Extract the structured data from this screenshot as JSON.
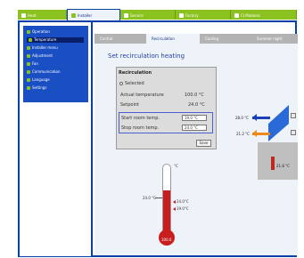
{
  "top_tabs": [
    {
      "label": "Heat",
      "active": false
    },
    {
      "label": "Installer",
      "active": true
    },
    {
      "label": "Service",
      "active": false
    },
    {
      "label": "Factory",
      "active": false
    },
    {
      "label": "CI Modules",
      "active": false
    }
  ],
  "sidebar": {
    "items": [
      {
        "label": "Operation",
        "active": false
      },
      {
        "label": "Temperature",
        "active": true
      },
      {
        "label": "Installer menu",
        "active": false
      },
      {
        "label": "Adjustment",
        "active": false
      },
      {
        "label": "Fan",
        "active": false
      },
      {
        "label": "Communication",
        "active": false
      },
      {
        "label": "Language",
        "active": false
      },
      {
        "label": "Settings",
        "active": false
      }
    ]
  },
  "sub_tabs": [
    {
      "label": "Control",
      "active": false
    },
    {
      "label": "Recirculation",
      "active": true
    },
    {
      "label": "Cooling",
      "active": false
    },
    {
      "label": "Summer night",
      "active": false
    }
  ],
  "page": {
    "heading": "Set recirculation heating"
  },
  "recirculation": {
    "title": "Recirculation",
    "selected_label": "Selected",
    "actual_temp_label": "Actual temperature",
    "actual_temp_value": "100.0 °C",
    "setpoint_label": "Setpoint",
    "setpoint_value": "24.0 °C",
    "start_label": "Start room temp.",
    "start_value": "19.0 °C",
    "stop_label": "Stop room temp.",
    "stop_value": "24.0 °C",
    "save_label": "Save"
  },
  "diagram": {
    "top_temp": "28.0 °C",
    "bottom_temp": "21.2 °C",
    "tank_temp": "21.8 °C"
  },
  "thermometer": {
    "unit": "°C",
    "current": "24.0 °C",
    "mark_high": "24.0°C",
    "mark_low": "19.0°C",
    "bulb_label": "100.0"
  },
  "colors": {
    "green": "#8cc21f",
    "blue": "#0a3fa8",
    "red": "#c81e1e",
    "orange": "#ee8a1a"
  }
}
